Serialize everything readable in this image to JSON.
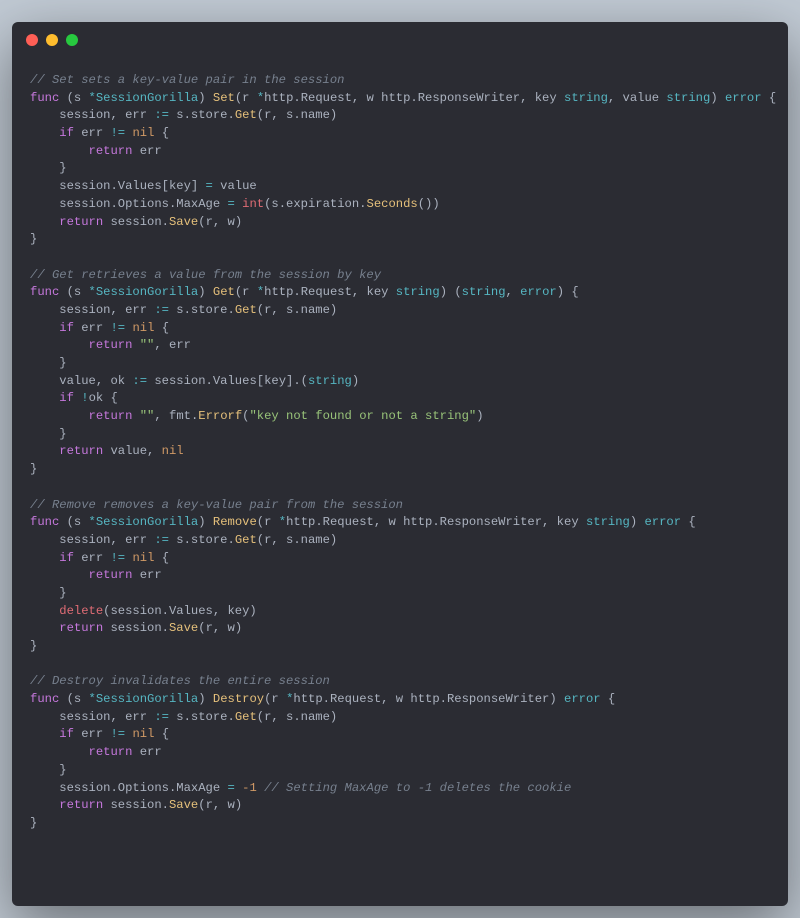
{
  "window": {
    "traffic": {
      "red": "close",
      "yellow": "minimize",
      "green": "zoom"
    }
  },
  "code": {
    "set": {
      "comment": "// Set sets a key-value pair in the session",
      "sig_func": "func",
      "sig_recv_open": " (s ",
      "sig_recv_star": "*",
      "sig_recv_type": "SessionGorilla",
      "sig_recv_close": ") ",
      "sig_name": "Set",
      "sig_args1": "(r ",
      "sig_star1": "*",
      "sig_type1": "http.Request",
      "sig_args2": ", w http.ResponseWriter, key ",
      "sig_str1": "string",
      "sig_args3": ", value ",
      "sig_str2": "string",
      "sig_args4": ") ",
      "sig_ret": "error",
      "brace_open": " {",
      "l1a": "    session, err ",
      "l1op": ":=",
      "l1b": " s.store.",
      "l1fn": "Get",
      "l1c": "(r, s.name)",
      "l2a": "    ",
      "l2if": "if",
      "l2b": " err ",
      "l2op": "!=",
      "l2c": " ",
      "l2nil": "nil",
      "l2d": " {",
      "l3a": "        ",
      "l3ret": "return",
      "l3b": " err",
      "l4": "    }",
      "l5a": "    session.Values[key] ",
      "l5op": "=",
      "l5b": " value",
      "l6a": "    session.Options.MaxAge ",
      "l6op": "=",
      "l6b": " ",
      "l6fn": "int",
      "l6c": "(s.expiration.",
      "l6fn2": "Seconds",
      "l6d": "())",
      "l7a": "    ",
      "l7ret": "return",
      "l7b": " session.",
      "l7fn": "Save",
      "l7c": "(r, w)",
      "brace_close": "}"
    },
    "get": {
      "comment": "// Get retrieves a value from the session by key",
      "sig_func": "func",
      "sig_recv_open": " (s ",
      "sig_recv_star": "*",
      "sig_recv_type": "SessionGorilla",
      "sig_recv_close": ") ",
      "sig_name": "Get",
      "sig_args1": "(r ",
      "sig_star1": "*",
      "sig_type1": "http.Request",
      "sig_args2": ", key ",
      "sig_str1": "string",
      "sig_args3": ") (",
      "sig_ret1": "string",
      "sig_args4": ", ",
      "sig_ret2": "error",
      "sig_args5": ") {",
      "l1a": "    session, err ",
      "l1op": ":=",
      "l1b": " s.store.",
      "l1fn": "Get",
      "l1c": "(r, s.name)",
      "l2a": "    ",
      "l2if": "if",
      "l2b": " err ",
      "l2op": "!=",
      "l2c": " ",
      "l2nil": "nil",
      "l2d": " {",
      "l3a": "        ",
      "l3ret": "return",
      "l3b": " ",
      "l3str": "\"\"",
      "l3c": ", err",
      "l4": "    }",
      "l5a": "    value, ok ",
      "l5op": ":=",
      "l5b": " session.Values[key].(",
      "l5type": "string",
      "l5c": ")",
      "l6a": "    ",
      "l6if": "if",
      "l6b": " ",
      "l6op": "!",
      "l6c": "ok {",
      "l7a": "        ",
      "l7ret": "return",
      "l7b": " ",
      "l7str": "\"\"",
      "l7c": ", fmt.",
      "l7fn": "Errorf",
      "l7d": "(",
      "l7str2": "\"key not found or not a string\"",
      "l7e": ")",
      "l8": "    }",
      "l9a": "    ",
      "l9ret": "return",
      "l9b": " value, ",
      "l9nil": "nil",
      "brace_close": "}"
    },
    "remove": {
      "comment": "// Remove removes a key-value pair from the session",
      "sig_func": "func",
      "sig_recv_open": " (s ",
      "sig_recv_star": "*",
      "sig_recv_type": "SessionGorilla",
      "sig_recv_close": ") ",
      "sig_name": "Remove",
      "sig_args1": "(r ",
      "sig_star1": "*",
      "sig_type1": "http.Request",
      "sig_args2": ", w http.ResponseWriter, key ",
      "sig_str1": "string",
      "sig_args3": ") ",
      "sig_ret": "error",
      "brace_open": " {",
      "l1a": "    session, err ",
      "l1op": ":=",
      "l1b": " s.store.",
      "l1fn": "Get",
      "l1c": "(r, s.name)",
      "l2a": "    ",
      "l2if": "if",
      "l2b": " err ",
      "l2op": "!=",
      "l2c": " ",
      "l2nil": "nil",
      "l2d": " {",
      "l3a": "        ",
      "l3ret": "return",
      "l3b": " err",
      "l4": "    }",
      "l5a": "    ",
      "l5fn": "delete",
      "l5b": "(session.Values, key)",
      "l6a": "    ",
      "l6ret": "return",
      "l6b": " session.",
      "l6fn": "Save",
      "l6c": "(r, w)",
      "brace_close": "}"
    },
    "destroy": {
      "comment": "// Destroy invalidates the entire session",
      "sig_func": "func",
      "sig_recv_open": " (s ",
      "sig_recv_star": "*",
      "sig_recv_type": "SessionGorilla",
      "sig_recv_close": ") ",
      "sig_name": "Destroy",
      "sig_args1": "(r ",
      "sig_star1": "*",
      "sig_type1": "http.Request",
      "sig_args2": ", w http.ResponseWriter) ",
      "sig_ret": "error",
      "brace_open": " {",
      "l1a": "    session, err ",
      "l1op": ":=",
      "l1b": " s.store.",
      "l1fn": "Get",
      "l1c": "(r, s.name)",
      "l2a": "    ",
      "l2if": "if",
      "l2b": " err ",
      "l2op": "!=",
      "l2c": " ",
      "l2nil": "nil",
      "l2d": " {",
      "l3a": "        ",
      "l3ret": "return",
      "l3b": " err",
      "l4": "    }",
      "l5a": "    session.Options.MaxAge ",
      "l5op": "=",
      "l5b": " ",
      "l5num": "-1",
      "l5c": " ",
      "l5comment": "// Setting MaxAge to -1 deletes the cookie",
      "l6a": "    ",
      "l6ret": "return",
      "l6b": " session.",
      "l6fn": "Save",
      "l6c": "(r, w)",
      "brace_close": "}"
    }
  }
}
